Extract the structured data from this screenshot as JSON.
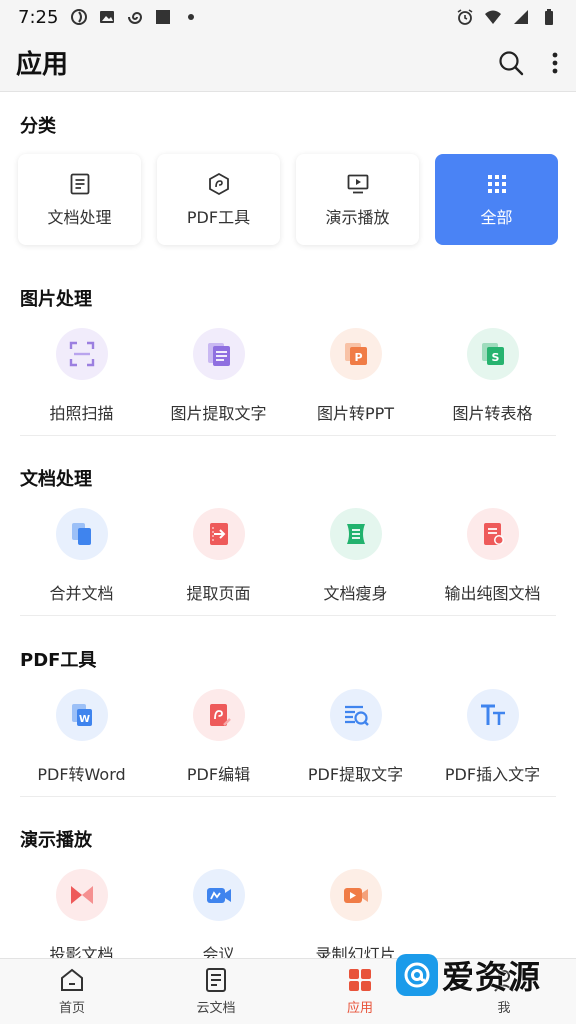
{
  "status_bar": {
    "time": "7:25"
  },
  "header": {
    "title": "应用"
  },
  "categories": {
    "title": "分类",
    "items": [
      {
        "label": "文档处理",
        "icon": "document-icon"
      },
      {
        "label": "PDF工具",
        "icon": "pdf-icon"
      },
      {
        "label": "演示播放",
        "icon": "presentation-icon"
      },
      {
        "label": "全部",
        "icon": "grid-icon",
        "active": true
      }
    ]
  },
  "image_processing": {
    "title": "图片处理",
    "items": [
      {
        "label": "拍照扫描",
        "icon": "scan-icon"
      },
      {
        "label": "图片提取文字",
        "icon": "image-text-icon"
      },
      {
        "label": "图片转PPT",
        "icon": "image-to-ppt-icon"
      },
      {
        "label": "图片转表格",
        "icon": "image-to-sheet-icon"
      }
    ]
  },
  "doc_processing": {
    "title": "文档处理",
    "items": [
      {
        "label": "合并文档",
        "icon": "merge-icon"
      },
      {
        "label": "提取页面",
        "icon": "extract-page-icon"
      },
      {
        "label": "文档瘦身",
        "icon": "slim-icon"
      },
      {
        "label": "输出纯图文档",
        "icon": "image-doc-icon"
      }
    ]
  },
  "pdf_tools": {
    "title": "PDF工具",
    "items": [
      {
        "label": "PDF转Word",
        "icon": "pdf-to-word-icon"
      },
      {
        "label": "PDF编辑",
        "icon": "pdf-edit-icon"
      },
      {
        "label": "PDF提取文字",
        "icon": "pdf-extract-text-icon"
      },
      {
        "label": "PDF插入文字",
        "icon": "pdf-insert-text-icon"
      }
    ]
  },
  "presentation": {
    "title": "演示播放",
    "items": [
      {
        "label": "投影文档",
        "icon": "projection-icon"
      },
      {
        "label": "会议",
        "icon": "meeting-icon"
      },
      {
        "label": "录制幻灯片",
        "icon": "record-slides-icon"
      }
    ]
  },
  "bottom_nav": {
    "items": [
      {
        "label": "首页",
        "icon": "home-icon"
      },
      {
        "label": "云文档",
        "icon": "cloud-doc-icon"
      },
      {
        "label": "应用",
        "icon": "apps-icon",
        "active": true
      },
      {
        "label": "我",
        "icon": "profile-icon"
      }
    ]
  },
  "watermark": {
    "text": "爱资源"
  },
  "colors": {
    "accent_blue": "#4a83f5",
    "active_nav": "#e8533a"
  }
}
